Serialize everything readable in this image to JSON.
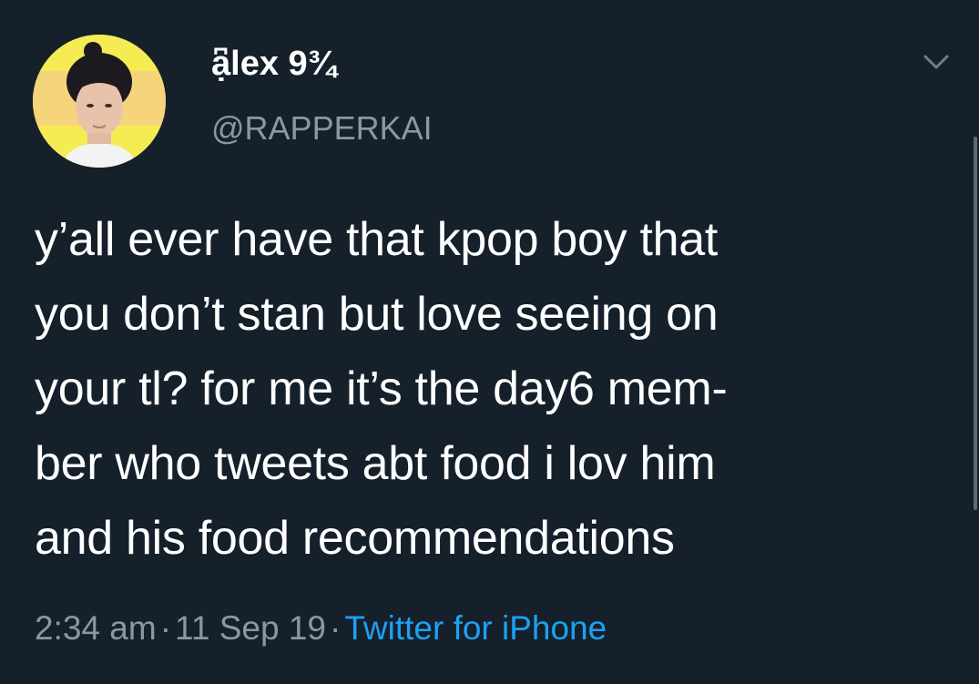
{
  "tweet": {
    "display_name": "ạ͆lex 9¾",
    "handle": "@RAPPERKAI",
    "body_lines": [
      "y’all ever have that kpop boy that",
      "you don’t stan but love seeing on",
      "your tl? for me it’s the day6 mem-",
      "ber who tweets abt food i lov him",
      "and his food recommendations"
    ],
    "time": "2:34 am",
    "date": "11 Sep 19",
    "separator": "·",
    "source": "Twitter for iPhone"
  },
  "icons": {
    "menu": "chevron-down-icon"
  },
  "colors": {
    "background": "#15202b",
    "text": "#ffffff",
    "secondary": "#8899a6",
    "link": "#1da1f2"
  }
}
